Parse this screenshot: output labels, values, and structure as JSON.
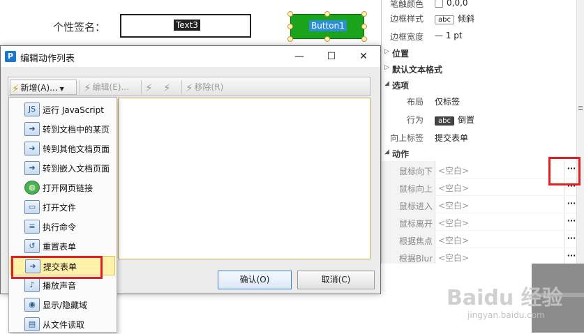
{
  "form": {
    "signature_label": "个性签名：",
    "text_field_name": "Text3",
    "button_name": "Button1"
  },
  "properties": {
    "rows_top": [
      {
        "label": "笔触颜色",
        "value": "0,0,0"
      },
      {
        "label": "边框样式",
        "chip": "abc",
        "value": "倾斜"
      },
      {
        "label": "边框宽度",
        "value": "— 1 pt"
      }
    ],
    "sections": {
      "position": "位置",
      "default_text_format": "默认文本格式",
      "options": "选项",
      "actions": "动作"
    },
    "option_rows": [
      {
        "label": "布局",
        "value": "仅标签"
      },
      {
        "label": "行为",
        "chip": "abc",
        "value": "倒置"
      },
      {
        "label": "向上标签",
        "value": "提交表单"
      }
    ],
    "action_rows": [
      {
        "label": "鼠标向下",
        "value": "<空白>",
        "button": "···"
      },
      {
        "label": "鼠标向上",
        "value": "<空白>",
        "button": "···"
      },
      {
        "label": "鼠标进入",
        "value": "<空白>",
        "button": "···"
      },
      {
        "label": "鼠标离开",
        "value": "<空白>",
        "button": "···"
      },
      {
        "label": "根据焦点",
        "value": "<空白>",
        "button": "···"
      },
      {
        "label": "根据Blur",
        "value": "<空白>",
        "button": "···"
      }
    ]
  },
  "dialog": {
    "title": "编辑动作列表",
    "icon_letter": "P",
    "controls": {
      "minimize": "—",
      "maximize": "☐",
      "close": "✕"
    },
    "toolbar": {
      "add": "新增(A)...",
      "edit": "编辑(E)...",
      "remove": "移除(R)"
    },
    "ok": "确认(O)",
    "cancel": "取消(C)"
  },
  "menu": {
    "items": [
      {
        "label": "运行 JavaScript",
        "icon": "script-icon"
      },
      {
        "label": "转到文档中的某页",
        "icon": "page-icon"
      },
      {
        "label": "转到其他文档页面",
        "icon": "document-icon"
      },
      {
        "label": "转到嵌入文档页面",
        "icon": "embedded-document-icon"
      },
      {
        "label": "打开网页链接",
        "icon": "globe-icon"
      },
      {
        "label": "打开文件",
        "icon": "open-file-icon"
      },
      {
        "label": "执行命令",
        "icon": "command-icon"
      },
      {
        "label": "重置表单",
        "icon": "reset-form-icon"
      },
      {
        "label": "提交表单",
        "icon": "submit-form-icon"
      },
      {
        "label": "播放声音",
        "icon": "speaker-icon"
      },
      {
        "label": "显示/隐藏域",
        "icon": "eye-icon"
      },
      {
        "label": "从文件读取",
        "icon": "read-file-icon"
      }
    ],
    "highlighted_index": 8
  },
  "watermark": {
    "main": "Baidu 经验",
    "sub": "jingyan.baidu.com"
  },
  "colors": {
    "accent_red": "#e02020",
    "button_green": "#1ca31c",
    "highlight_yellow": "#fff1a8"
  }
}
